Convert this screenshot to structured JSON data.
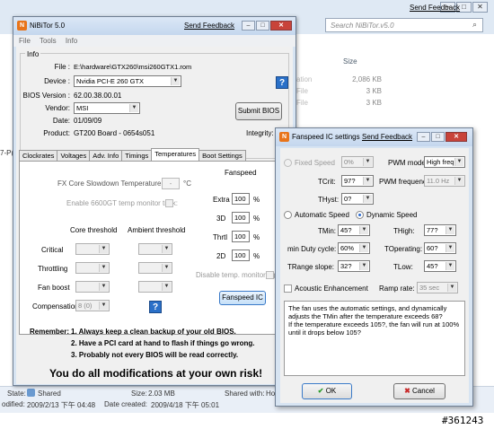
{
  "explorer": {
    "feedback": "Send Feedback",
    "search_placeholder": "Search NiBiTor.v5.0",
    "col_size": "Size",
    "rows": [
      {
        "name": "ation",
        "size": "2,086 KB"
      },
      {
        "name": "File",
        "size": "3 KB"
      },
      {
        "name": "File",
        "size": "3 KB"
      }
    ],
    "left_fragment": "7-P(",
    "status": {
      "state_label": "State:",
      "state_value": "Shared",
      "size_label": "Size:",
      "size_value": "2.03 MB",
      "shared_label": "Shared with:",
      "shared_value": "Homegroup",
      "modified_label": "odified:",
      "modified_value": "2009/2/13 下午 04:48",
      "created_label": "Date created:",
      "created_value": "2009/4/18 下午 05:01"
    }
  },
  "nibitor": {
    "title": "NiBiTor 5.0",
    "feedback": "Send Feedback",
    "menu": [
      "File",
      "Tools",
      "Info"
    ],
    "info_label": "Info",
    "file_label": "File :",
    "file_value": "E:\\hardware\\GTX260\\msi260GTX1.rom",
    "device_label": "Device :",
    "device_value": "Nvidia PCI-E 260 GTX",
    "bios_label": "BIOS Version :",
    "bios_value": "62.00.38.00.01",
    "vendor_label": "Vendor:",
    "vendor_value": "MSI",
    "date_label": "Date:",
    "date_value": "01/09/09",
    "product_label": "Product:",
    "product_value": "GT200 Board - 0654s051",
    "submit_bios": "Submit BIOS",
    "integrity_label": "Integrity:",
    "tabs": [
      "Clockrates",
      "Voltages",
      "Adv. Info",
      "Timings",
      "Temperatures",
      "Boot Settings"
    ],
    "temp": {
      "slowdown_label": "FX Core Slowdown Temperature :",
      "slowdown_value": "-",
      "slowdown_unit": "°C",
      "trick_label": "Enable 6600GT temp monitor trick:",
      "fanspeed_head": "Fanspeed",
      "fan_rows": [
        {
          "label": "Extra",
          "value": "100",
          "unit": "%"
        },
        {
          "label": "3D",
          "value": "100",
          "unit": "%"
        },
        {
          "label": "Thrtl",
          "value": "100",
          "unit": "%"
        },
        {
          "label": "2D",
          "value": "100",
          "unit": "%"
        }
      ],
      "core_head": "Core threshold",
      "ambient_head": "Ambient threshold",
      "rows": [
        "Critical",
        "Throttling",
        "Fan boost"
      ],
      "compensation_label": "Compensation",
      "compensation_value": "8 (0)",
      "disable_monitor": "Disable temp. monitoring:",
      "fanspeed_ic_button": "Fanspeed IC"
    },
    "remember_label": "Remember:",
    "remember_items": [
      "1. Always keep a clean backup of your old BIOS.",
      "2. Have a PCI card at hand to flash if things go wrong.",
      "3. Probably not every BIOS will be read correctly."
    ],
    "warning": "You do all modifications at your own risk!"
  },
  "fan_dialog": {
    "title": "Fanspeed IC settings",
    "feedback": "Send Feedback",
    "fixed_speed_label": "Fixed Speed",
    "fixed_speed_value": "0%",
    "pwm_mode_label": "PWM mode:",
    "pwm_mode_value": "High freq",
    "tcrit_label": "TCrit:",
    "tcrit_value": "97?",
    "pwm_freq_label": "PWM frequency:",
    "pwm_freq_value": "11.0 Hz",
    "thyst_label": "THyst:",
    "thyst_value": "0?",
    "auto_speed_label": "Automatic Speed",
    "dyn_speed_label": "Dynamic Speed",
    "tmin_label": "TMin:",
    "tmin_value": "45?",
    "thigh_label": "THigh:",
    "thigh_value": "77?",
    "min_duty_label": "min Duty cycle:",
    "min_duty_value": "60%",
    "toperating_label": "TOperating:",
    "toperating_value": "60?",
    "trange_label": "TRange slope:",
    "trange_value": "32?",
    "tlow_label": "TLow:",
    "tlow_value": "45?",
    "acoustic_label": "Acoustic Enhancement",
    "ramp_label": "Ramp rate:",
    "ramp_value": "35 sec",
    "info_text": "The fan uses the automatic settings, and dynamically adjusts the TMin after the temperature exceeds 68?\nIf the temperature exceeds 105?, the fan will run at 100% until it drops below 105?",
    "ok_label": "OK",
    "cancel_label": "Cancel"
  },
  "watermark": "#361243"
}
